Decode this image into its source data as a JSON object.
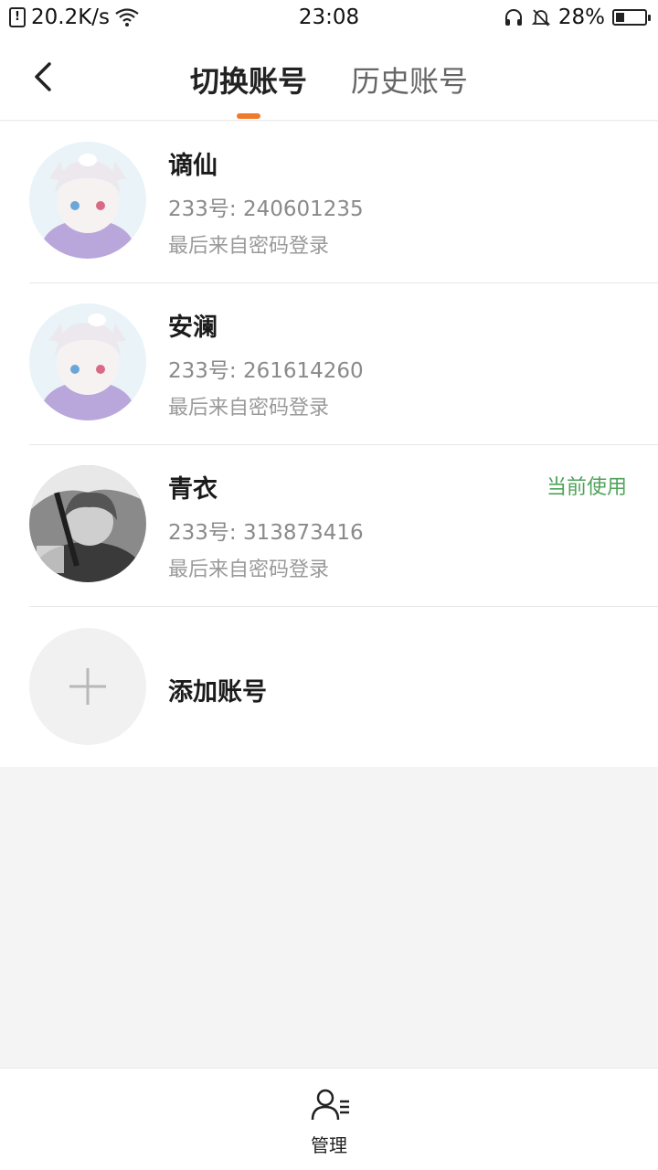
{
  "status_bar": {
    "speed": "20.2K/s",
    "time": "23:08",
    "battery": "28%",
    "battery_level": 0.28
  },
  "header": {
    "tabs": [
      {
        "label": "切换账号",
        "active": true
      },
      {
        "label": "历史账号",
        "active": false
      }
    ]
  },
  "accounts": [
    {
      "name": "谪仙",
      "uid": "233号: 240601235",
      "source": "最后来自密码登录",
      "current": ""
    },
    {
      "name": "安澜",
      "uid": "233号: 261614260",
      "source": "最后来自密码登录",
      "current": ""
    },
    {
      "name": "青衣",
      "uid": "233号: 313873416",
      "source": "最后来自密码登录",
      "current": "当前使用"
    }
  ],
  "add_account": {
    "label": "添加账号"
  },
  "bottom_bar": {
    "manage_label": "管理"
  },
  "colors": {
    "accent": "#f07a2a",
    "current": "#4fa35a"
  }
}
